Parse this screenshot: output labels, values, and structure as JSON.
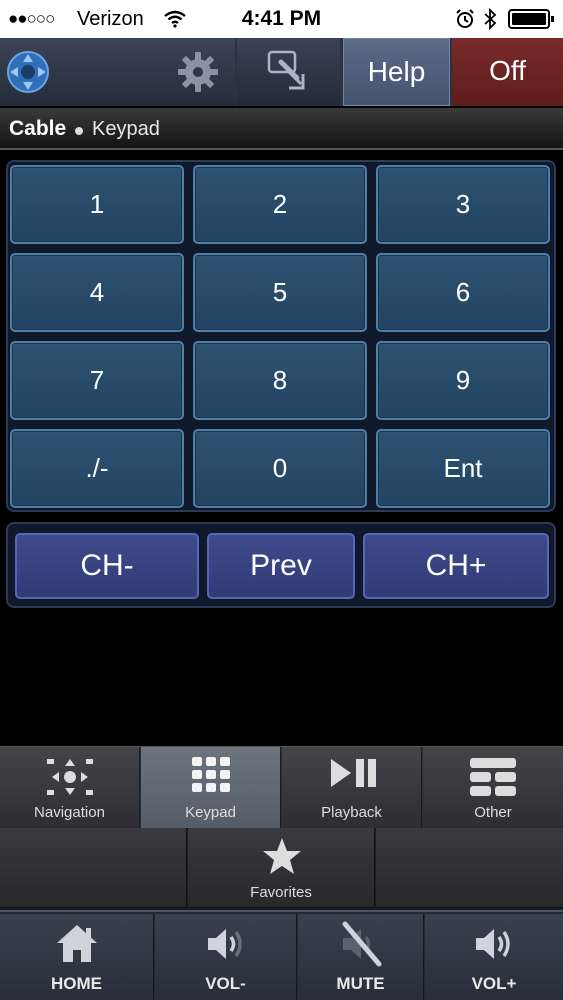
{
  "status_bar": {
    "signal": "●●○○○",
    "carrier": "Verizon",
    "time": "4:41 PM"
  },
  "toolbar": {
    "help_label": "Help",
    "off_label": "Off"
  },
  "breadcrumb": {
    "device": "Cable",
    "page": "Keypad"
  },
  "keypad": {
    "keys": [
      "1",
      "2",
      "3",
      "4",
      "5",
      "6",
      "7",
      "8",
      "9",
      "./-",
      "0",
      "Ent"
    ]
  },
  "channel": {
    "ch_down": "CH-",
    "prev": "Prev",
    "ch_up": "CH+"
  },
  "tabs": [
    {
      "label": "Navigation"
    },
    {
      "label": "Keypad",
      "active": true
    },
    {
      "label": "Playback"
    },
    {
      "label": "Other"
    }
  ],
  "favorites": {
    "label": "Favorites"
  },
  "controls": [
    {
      "label": "HOME"
    },
    {
      "label": "VOL-"
    },
    {
      "label": "MUTE"
    },
    {
      "label": "VOL+"
    }
  ],
  "colors": {
    "key_fill": "#2e5272",
    "key_border": "#4f7fa8",
    "channel_fill": "#3f4a8c",
    "off_fill": "#7a2a2a",
    "help_fill": "#5b6a88"
  }
}
